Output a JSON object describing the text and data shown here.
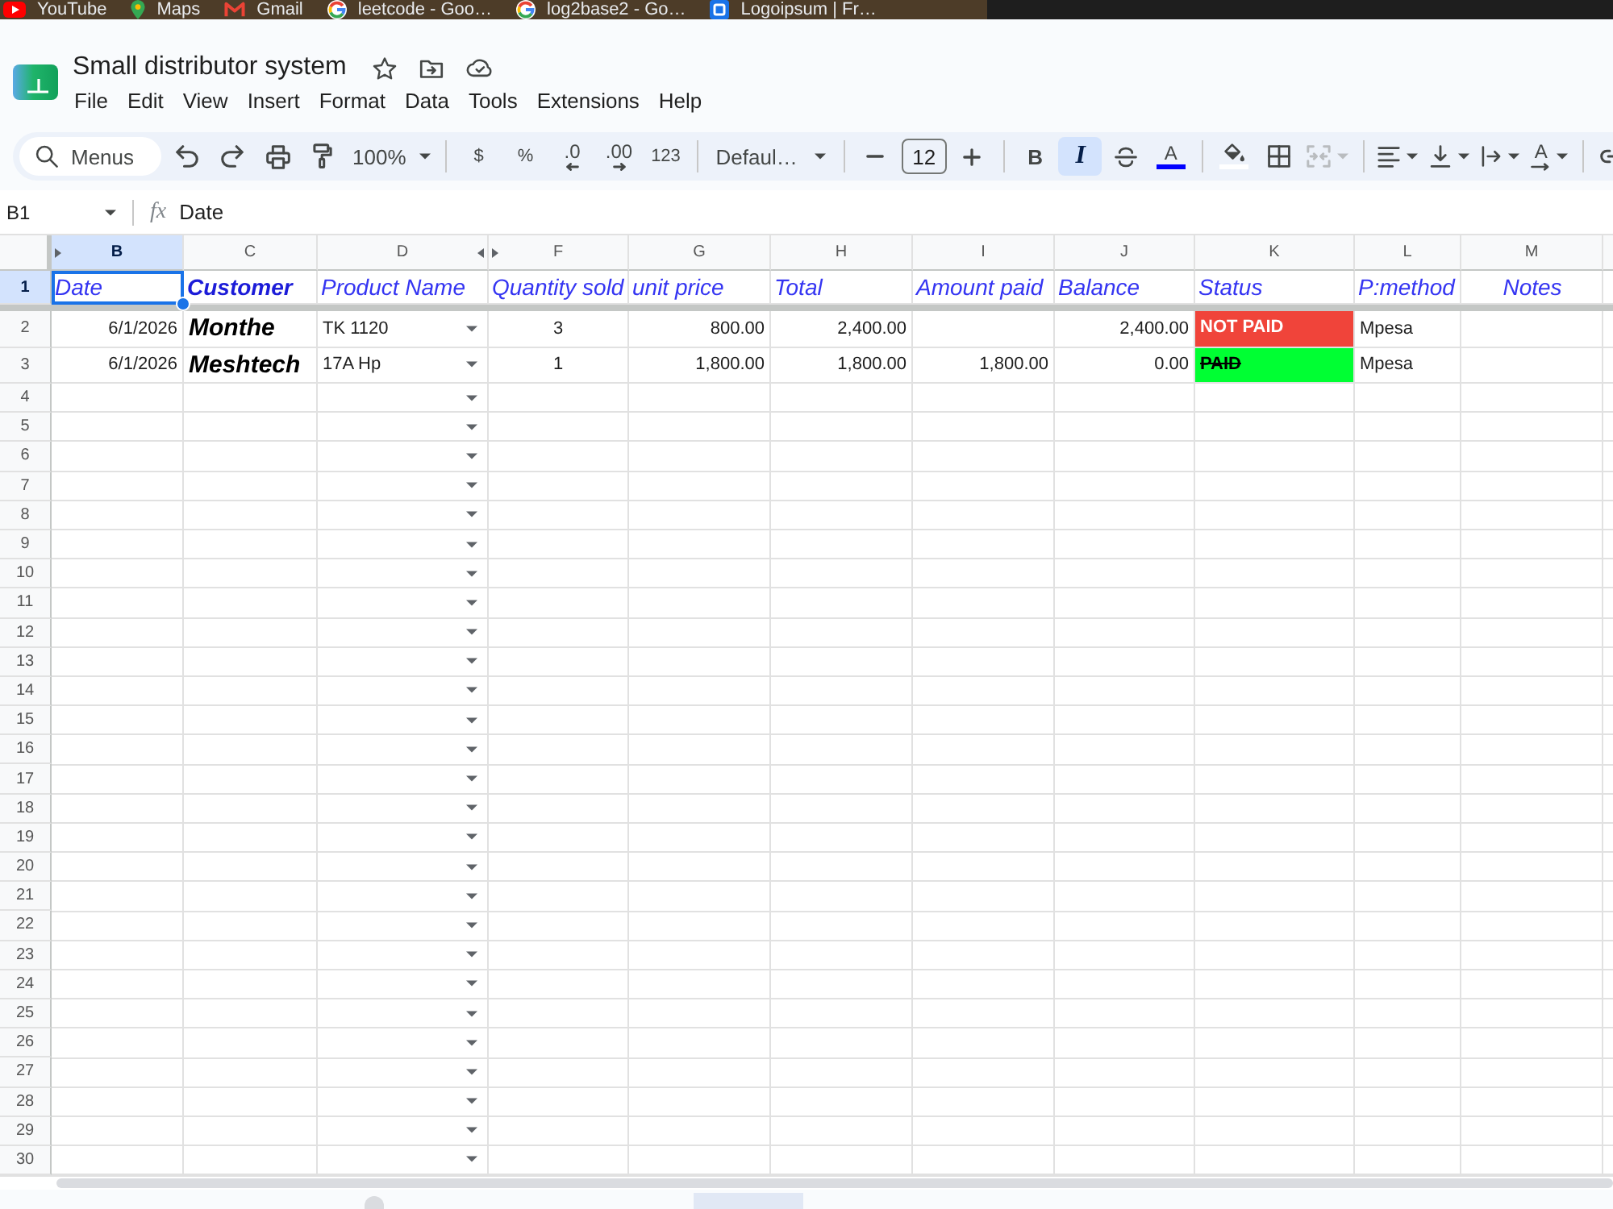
{
  "bookmarks": [
    {
      "kind": "video",
      "label": "YouTube"
    },
    {
      "kind": "pin",
      "label": "Maps"
    },
    {
      "kind": "mail",
      "label": "Gmail"
    },
    {
      "kind": "search",
      "label": "leetcode - Goo…"
    },
    {
      "kind": "search",
      "label": "log2base2 - Go…"
    },
    {
      "kind": "site",
      "label": "Logoipsum | Fr…"
    }
  ],
  "document": {
    "title": "Small distributor system"
  },
  "menu": [
    "File",
    "Edit",
    "View",
    "Insert",
    "Format",
    "Data",
    "Tools",
    "Extensions",
    "Help"
  ],
  "toolbar": {
    "search": {
      "placeholder": "Menus"
    },
    "groups": [
      [
        {
          "kind": "undo",
          "selected": false,
          "disabled": false
        },
        {
          "kind": "redo",
          "selected": false,
          "disabled": false
        },
        {
          "kind": "print",
          "selected": false,
          "disabled": false
        },
        {
          "kind": "paint_format",
          "selected": false,
          "disabled": false
        },
        {
          "kind": "zoom",
          "label": "100%",
          "selected": false,
          "disabled": false
        }
      ],
      [
        {
          "kind": "currency",
          "label": "$",
          "selected": false,
          "disabled": false
        },
        {
          "kind": "percent",
          "label": "%",
          "selected": false,
          "disabled": false
        },
        {
          "kind": "decrease_decimals",
          "label": ".0",
          "selected": false,
          "disabled": false
        },
        {
          "kind": "increase_decimals",
          "label": ".00",
          "selected": false,
          "disabled": false
        },
        {
          "kind": "number_format",
          "label": "123",
          "selected": false,
          "disabled": false
        }
      ],
      [
        {
          "kind": "font",
          "label": "Defaul…",
          "selected": false,
          "disabled": false
        }
      ],
      [
        {
          "kind": "size_down",
          "selected": false,
          "disabled": false
        },
        {
          "kind": "font_size",
          "value": "12",
          "selected": false,
          "disabled": false
        },
        {
          "kind": "size_up",
          "selected": false,
          "disabled": false
        }
      ],
      [
        {
          "kind": "bold",
          "label": "B",
          "selected": false,
          "disabled": false
        },
        {
          "kind": "italic",
          "label": "I",
          "selected": true,
          "disabled": false
        },
        {
          "kind": "strikethrough",
          "selected": false,
          "disabled": false
        },
        {
          "kind": "text_color",
          "label": "A",
          "color": "#0000ff",
          "selected": false,
          "disabled": false
        }
      ],
      [
        {
          "kind": "fill_color",
          "color": "#ffffff",
          "selected": false,
          "disabled": false
        },
        {
          "kind": "borders",
          "selected": false,
          "disabled": false
        },
        {
          "kind": "merge",
          "selected": false,
          "disabled": true
        }
      ],
      [
        {
          "kind": "halign",
          "selected": false,
          "disabled": false
        },
        {
          "kind": "valign",
          "selected": false,
          "disabled": false
        },
        {
          "kind": "wrap",
          "selected": false,
          "disabled": false
        },
        {
          "kind": "rotate",
          "label": "A",
          "selected": false,
          "disabled": false
        }
      ],
      [
        {
          "kind": "link",
          "selected": false,
          "disabled": false
        }
      ]
    ]
  },
  "formula_bar": {
    "cell": "B1",
    "label": "fx",
    "value": "Date"
  },
  "grid": {
    "columns": [
      {
        "letter": "B",
        "selected": true,
        "hidden_before": true
      },
      {
        "letter": "C",
        "selected": false,
        "hidden_before": false
      },
      {
        "letter": "D",
        "selected": false,
        "hidden_before": false
      },
      {
        "letter": "F",
        "selected": false,
        "hidden_before": true
      },
      {
        "letter": "G",
        "selected": false,
        "hidden_before": false
      },
      {
        "letter": "H",
        "selected": false,
        "hidden_before": false
      },
      {
        "letter": "I",
        "selected": false,
        "hidden_before": false
      },
      {
        "letter": "J",
        "selected": false,
        "hidden_before": false
      },
      {
        "letter": "K",
        "selected": false,
        "hidden_before": false
      },
      {
        "letter": "L",
        "selected": false,
        "hidden_before": false
      },
      {
        "letter": "M",
        "selected": false,
        "hidden_before": false
      }
    ],
    "rows": [
      {
        "number": "1",
        "selected": true,
        "kind": "header",
        "dropdown": false,
        "cells": {
          "date": "Date",
          "customer": "Customer",
          "product": "Product Name",
          "quantity_sold": "Quantity sold",
          "unit_price": "unit price",
          "total": "Total",
          "amount_paid": "Amount paid",
          "balance": "Balance",
          "status": "Status",
          "payment_method": "P:method",
          "notes": "Notes"
        }
      },
      {
        "number": "2",
        "selected": false,
        "kind": "data",
        "dropdown": true,
        "cells": {
          "date": "6/1/2026",
          "customer": "Monthe",
          "product": "TK 1120",
          "quantity_sold": "3",
          "unit_price": "800.00",
          "total": "2,400.00",
          "balance": "2,400.00",
          "status": {
            "text": "NOT PAID",
            "kind": "unpaid",
            "color": "#f0443a",
            "strikethrough": false
          },
          "payment_method": "Mpesa"
        }
      },
      {
        "number": "3",
        "selected": false,
        "kind": "data",
        "dropdown": true,
        "cells": {
          "date": "6/1/2026",
          "customer": "Meshtech",
          "product": "17A Hp",
          "quantity_sold": "1",
          "unit_price": "1,800.00",
          "total": "1,800.00",
          "amount_paid": "1,800.00",
          "balance": "0.00",
          "status": {
            "text": "PAID",
            "kind": "paid",
            "color": "#00ff33",
            "strikethrough": true
          },
          "payment_method": "Mpesa"
        }
      },
      {
        "number": "4",
        "selected": false,
        "kind": "empty",
        "dropdown": true
      },
      {
        "number": "5",
        "selected": false,
        "kind": "empty",
        "dropdown": true
      },
      {
        "number": "6",
        "selected": false,
        "kind": "empty",
        "dropdown": true
      },
      {
        "number": "7",
        "selected": false,
        "kind": "empty",
        "dropdown": true
      },
      {
        "number": "8",
        "selected": false,
        "kind": "empty",
        "dropdown": true
      },
      {
        "number": "9",
        "selected": false,
        "kind": "empty",
        "dropdown": true
      },
      {
        "number": "10",
        "selected": false,
        "kind": "empty",
        "dropdown": true
      },
      {
        "number": "11",
        "selected": false,
        "kind": "empty",
        "dropdown": true
      },
      {
        "number": "12",
        "selected": false,
        "kind": "empty",
        "dropdown": true
      },
      {
        "number": "13",
        "selected": false,
        "kind": "empty",
        "dropdown": true
      },
      {
        "number": "14",
        "selected": false,
        "kind": "empty",
        "dropdown": true
      },
      {
        "number": "15",
        "selected": false,
        "kind": "empty",
        "dropdown": true
      },
      {
        "number": "16",
        "selected": false,
        "kind": "empty",
        "dropdown": true
      },
      {
        "number": "17",
        "selected": false,
        "kind": "empty",
        "dropdown": true
      },
      {
        "number": "18",
        "selected": false,
        "kind": "empty",
        "dropdown": true
      },
      {
        "number": "19",
        "selected": false,
        "kind": "empty",
        "dropdown": true
      },
      {
        "number": "20",
        "selected": false,
        "kind": "empty",
        "dropdown": true
      },
      {
        "number": "21",
        "selected": false,
        "kind": "empty",
        "dropdown": true
      },
      {
        "number": "22",
        "selected": false,
        "kind": "empty",
        "dropdown": true
      },
      {
        "number": "23",
        "selected": false,
        "kind": "empty",
        "dropdown": true
      },
      {
        "number": "24",
        "selected": false,
        "kind": "empty",
        "dropdown": true
      },
      {
        "number": "25",
        "selected": false,
        "kind": "empty",
        "dropdown": true
      },
      {
        "number": "26",
        "selected": false,
        "kind": "empty",
        "dropdown": true
      },
      {
        "number": "27",
        "selected": false,
        "kind": "empty",
        "dropdown": true
      },
      {
        "number": "28",
        "selected": false,
        "kind": "empty",
        "dropdown": true
      },
      {
        "number": "29",
        "selected": false,
        "kind": "empty",
        "dropdown": true
      },
      {
        "number": "30",
        "selected": false,
        "kind": "empty",
        "dropdown": true
      }
    ]
  }
}
